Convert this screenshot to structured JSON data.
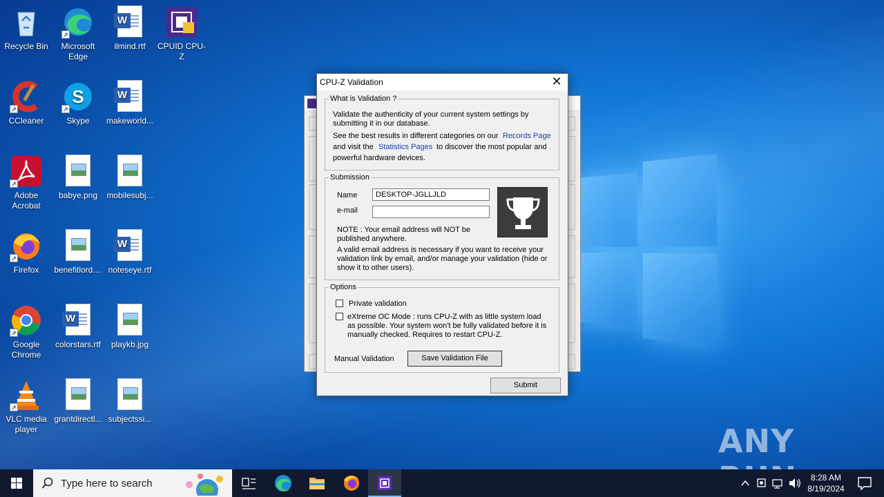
{
  "desktop": {
    "icons": [
      {
        "label": "Recycle Bin",
        "icon": "recycle-bin-icon"
      },
      {
        "label": "Microsoft Edge",
        "icon": "edge-icon"
      },
      {
        "label": "ilmind.rtf",
        "icon": "word-document-icon"
      },
      {
        "label": "CPUID CPU-Z",
        "icon": "cpuz-icon"
      },
      {
        "label": "CCleaner",
        "icon": "ccleaner-icon"
      },
      {
        "label": "Skype",
        "icon": "skype-icon"
      },
      {
        "label": "makeworld...",
        "icon": "word-document-icon"
      },
      {
        "label": "Adobe Acrobat",
        "icon": "acrobat-icon"
      },
      {
        "label": "babye.png",
        "icon": "image-file-icon"
      },
      {
        "label": "mobilesubj...",
        "icon": "image-file-icon"
      },
      {
        "label": "Firefox",
        "icon": "firefox-icon"
      },
      {
        "label": "benefitlord....",
        "icon": "image-file-icon"
      },
      {
        "label": "noteseye.rtf",
        "icon": "word-document-icon"
      },
      {
        "label": "Google Chrome",
        "icon": "chrome-icon"
      },
      {
        "label": "colorstars.rtf",
        "icon": "word-document-icon"
      },
      {
        "label": "playkb.jpg",
        "icon": "image-file-icon"
      },
      {
        "label": "VLC media player",
        "icon": "vlc-icon"
      },
      {
        "label": "grantdirectl...",
        "icon": "image-file-icon"
      },
      {
        "label": "subjectssi...",
        "icon": "image-file-icon"
      }
    ]
  },
  "dialog": {
    "title": "CPU-Z Validation",
    "close_label": "✕",
    "what": {
      "legend": "What is Validation ?",
      "text1": "Validate the authenticity of your current system settings by submitting it in our database.",
      "text2a": "See the best results in different categories on our",
      "records_link": "Records Page",
      "text2b": "and visit the",
      "stats_link": "Statistics Pages",
      "text2c": "to discover the most popular and",
      "text2d": "powerful hardware devices."
    },
    "submission": {
      "legend": "Submission",
      "name_label": "Name",
      "name_value": "DESKTOP-JGLLJLD",
      "email_label": "e-mail",
      "email_value": "",
      "note": "NOTE : Your email address will NOT be published anywhere.",
      "note2": "A valid email address is necessary if you want to receive your validation link by email, and/or manage your validation (hide or show it to other users)."
    },
    "options": {
      "legend": "Options",
      "private_label": "Private validation",
      "private_checked": false,
      "extreme_label": "eXtreme OC Mode : runs CPU-Z with as little system load as possible. Your system won't be fully validated before it is manually checked. Requires to restart CPU-Z.",
      "extreme_checked": false,
      "manual_label": "Manual Validation",
      "save_button": "Save Validation File"
    },
    "submit_button": "Submit"
  },
  "taskbar": {
    "search_placeholder": "Type here to search",
    "time": "8:28 AM",
    "date": "8/19/2024"
  },
  "watermark": "ANY RUN"
}
